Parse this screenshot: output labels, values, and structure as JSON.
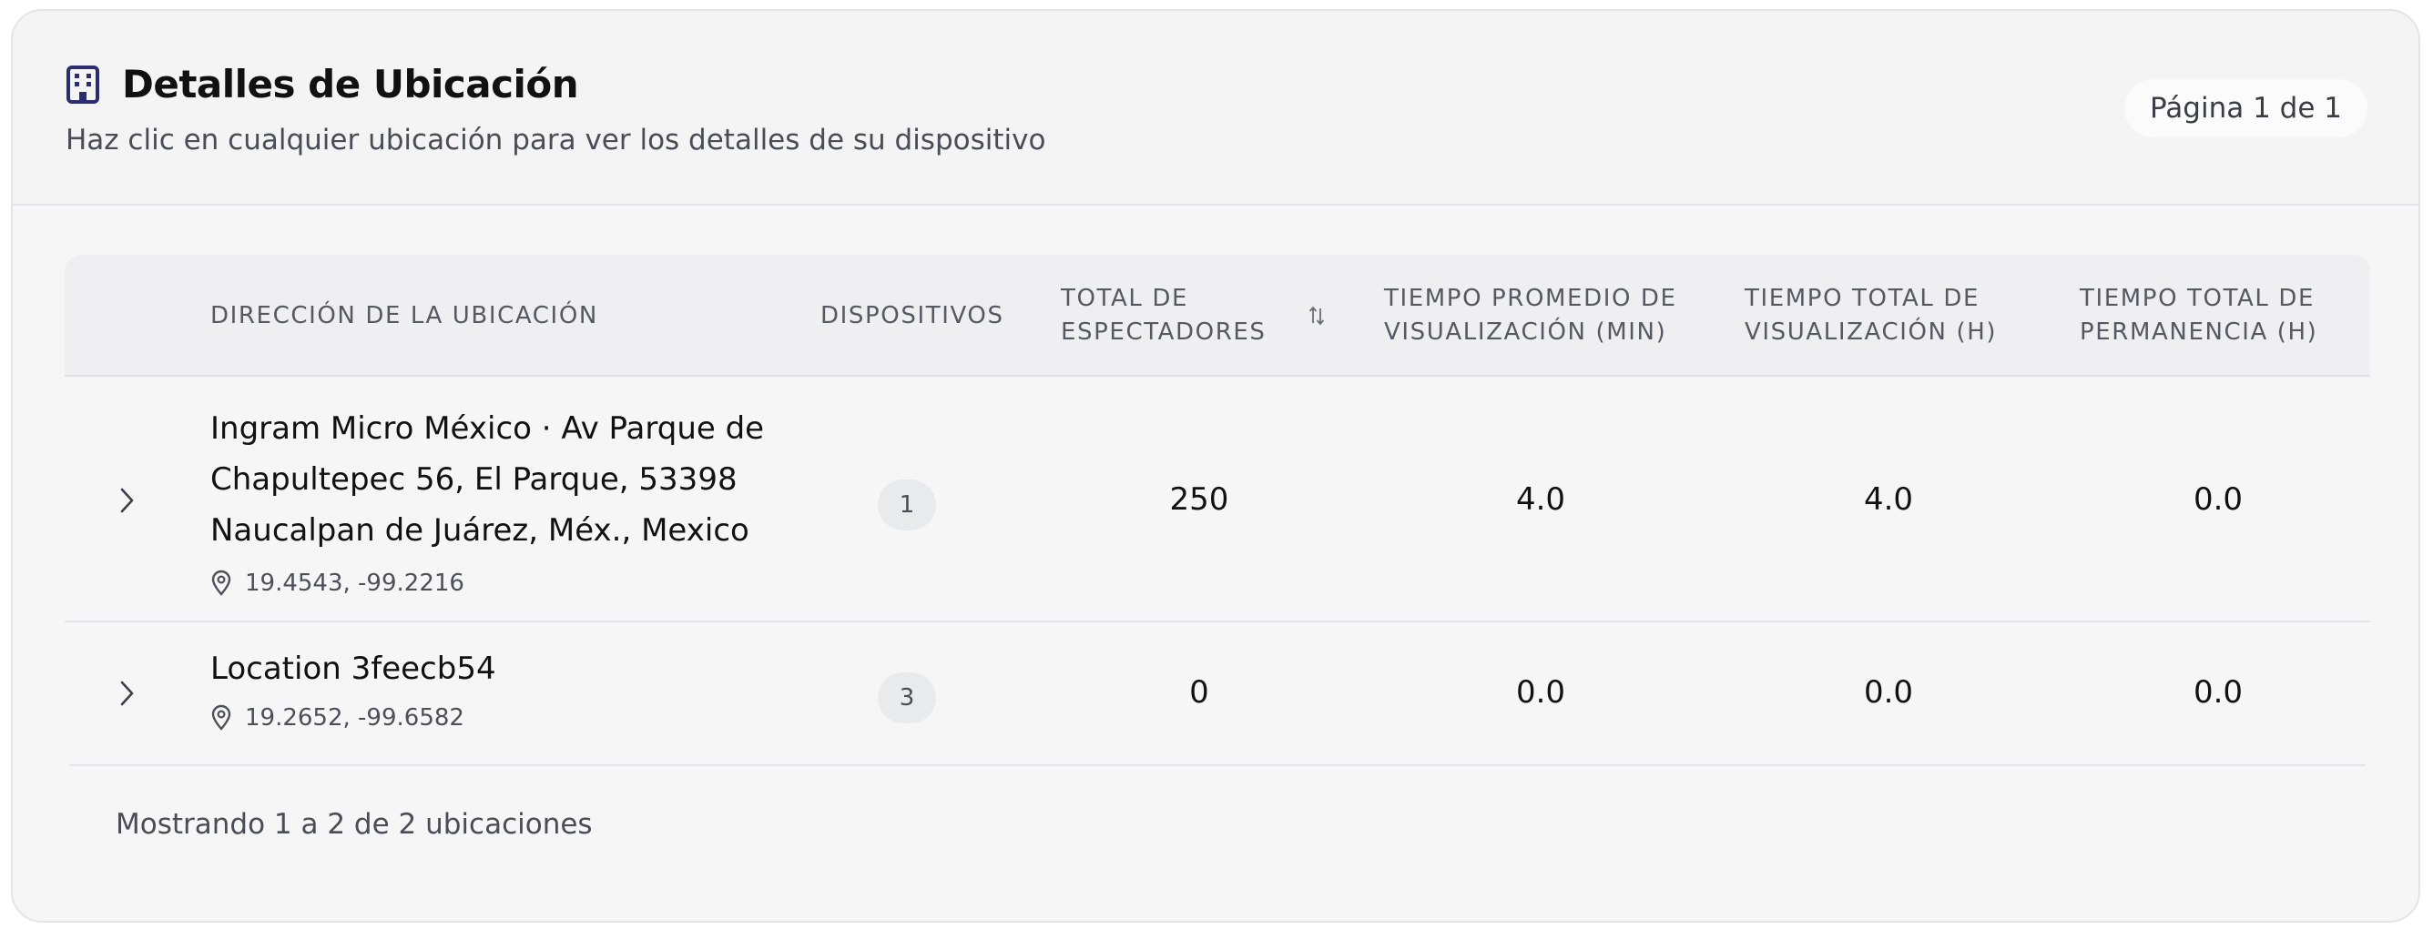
{
  "header": {
    "title": "Detalles de Ubicación",
    "subtitle": "Haz clic en cualquier ubicación para ver los detalles de su dispositivo",
    "page_indicator": "Página 1 de 1",
    "icon": "building-icon"
  },
  "table": {
    "columns": {
      "address": "DIRECCIÓN DE LA UBICACIÓN",
      "devices": "DISPOSITIVOS",
      "viewers_l1": "TOTAL DE",
      "viewers_l2": "ESPECTADORES",
      "avg_time_l1": "TIEMPO PROMEDIO DE",
      "avg_time_l2": "VISUALIZACIÓN (MIN)",
      "total_time_l1": "TIEMPO TOTAL DE",
      "total_time_l2": "VISUALIZACIÓN (H)",
      "dwell_l1": "TIEMPO TOTAL DE",
      "dwell_l2": "PERMANENCIA (H)"
    },
    "rows": [
      {
        "address_l1": "Ingram Micro México · Av Parque de",
        "address_l2": "Chapultepec 56, El Parque, 53398",
        "address_l3": "Naucalpan de Juárez, Méx., Mexico",
        "coords": "19.4543, -99.2216",
        "devices": "1",
        "viewers": "250",
        "avg_time": "4.0",
        "total_time": "4.0",
        "dwell": "0.0"
      },
      {
        "address_l1": "Location 3feecb54",
        "coords": "19.2652, -99.6582",
        "devices": "3",
        "viewers": "0",
        "avg_time": "0.0",
        "total_time": "0.0",
        "dwell": "0.0"
      }
    ]
  },
  "footer": {
    "summary": "Mostrando 1 a 2 de 2 ubicaciones"
  },
  "colors": {
    "icon_accent": "#2a2d6e",
    "text_primary": "#111111",
    "text_muted": "#4a4d55"
  }
}
